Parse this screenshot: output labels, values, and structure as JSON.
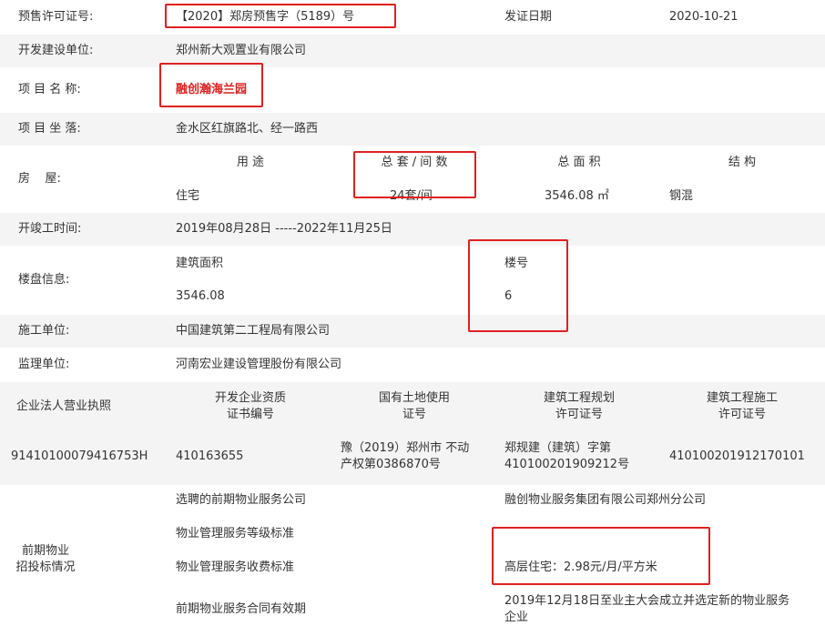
{
  "permit": {
    "label": "预售许可证号:",
    "value": "【2020】郑房预售字（5189）号",
    "date_label": "发证日期",
    "date_value": "2020-10-21"
  },
  "developer": {
    "label": "开发建设单位:",
    "value": "郑州新大观置业有限公司"
  },
  "project": {
    "label": "项 目 名 称:",
    "value": "融创瀚海兰园"
  },
  "location": {
    "label": "项 目 坐 落:",
    "value": "金水区红旗路北、经一路西"
  },
  "housing": {
    "label": "房    屋:",
    "headers": [
      "用 途",
      "总 套 / 间 数",
      "总 面 积",
      "结 构"
    ],
    "values": [
      "住宅",
      "24套/间",
      "3546.08 ㎡",
      "钢混"
    ]
  },
  "construction_period": {
    "label": "开竣工时间:",
    "value": "2019年08月28日 -----2022年11月25日"
  },
  "building": {
    "label": "楼盘信息:",
    "area_header": "建筑面积",
    "area_value": "3546.08",
    "number_header": "楼号",
    "number_value": "6"
  },
  "contractor": {
    "label": "施工单位:",
    "value": "中国建筑第二工程局有限公司"
  },
  "supervisor": {
    "label": "监理单位:",
    "value": "河南宏业建设管理股份有限公司"
  },
  "licenses": {
    "headers": [
      "企业法人营业执照",
      "开发企业资质\n证书编号",
      "国有土地使用\n证号",
      "建筑工程规划\n许可证号",
      "建筑工程施工\n许可证号"
    ],
    "values": [
      "91410100079416753H",
      "410163655",
      "豫（2019）郑州市 不动\n产权第0386870号",
      "郑规建（建筑）字第\n410100201909212号",
      "410100201912170101"
    ]
  },
  "property_service": {
    "label": "前期物业\n招投标情况",
    "items": [
      {
        "label": "选聘的前期物业服务公司",
        "value": "融创物业服务集团有限公司郑州分公司"
      },
      {
        "label": "物业管理服务等级标准",
        "value": ""
      },
      {
        "label": "物业管理服务收费标准",
        "value": "高层住宅：2.98元/月/平方米"
      },
      {
        "label": "前期物业服务合同有效期",
        "value": "2019年12月18日至业主大会成立并选定新的物业服务\n企业"
      }
    ]
  },
  "colors": {
    "highlight": "#e02020",
    "stripe": "#f4f4f4"
  }
}
